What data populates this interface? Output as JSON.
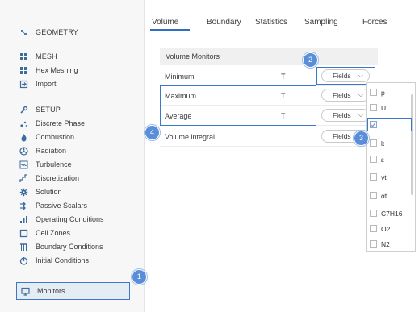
{
  "sidebar": {
    "items": [
      {
        "label": "GEOMETRY",
        "icon": "geometry-icon"
      },
      {
        "label": "MESH",
        "icon": "mesh-icon"
      },
      {
        "label": "Hex Meshing",
        "icon": "hex-meshing-icon"
      },
      {
        "label": "Import",
        "icon": "import-icon"
      },
      {
        "label": "SETUP",
        "icon": "wrench-icon"
      },
      {
        "label": "Discrete Phase",
        "icon": "discrete-phase-icon"
      },
      {
        "label": "Combustion",
        "icon": "flame-icon"
      },
      {
        "label": "Radiation",
        "icon": "radiation-icon"
      },
      {
        "label": "Turbulence",
        "icon": "turbulence-icon"
      },
      {
        "label": "Discretization",
        "icon": "discretization-icon"
      },
      {
        "label": "Solution",
        "icon": "gear-icon"
      },
      {
        "label": "Passive Scalars",
        "icon": "passive-scalars-icon"
      },
      {
        "label": "Operating Conditions",
        "icon": "operating-conditions-icon"
      },
      {
        "label": "Cell Zones",
        "icon": "cell-zones-icon"
      },
      {
        "label": "Boundary Conditions",
        "icon": "boundary-conditions-icon"
      },
      {
        "label": "Initial Conditions",
        "icon": "initial-conditions-icon"
      }
    ],
    "selected": {
      "label": "Monitors",
      "icon": "monitor-icon"
    }
  },
  "tabs": [
    "Volume",
    "Boundary",
    "Statistics",
    "Sampling",
    "Forces"
  ],
  "panel": {
    "title": "Volume Monitors",
    "rows": [
      {
        "name": "Minimum",
        "field": "T",
        "button": "Fields"
      },
      {
        "name": "Maximum",
        "field": "T",
        "button": "Fields"
      },
      {
        "name": "Average",
        "field": "T",
        "button": "Fields"
      },
      {
        "name": "Volume integral",
        "field": "",
        "button": "Fields"
      }
    ]
  },
  "dropdown": {
    "options": [
      {
        "label": "p",
        "checked": false
      },
      {
        "label": "U",
        "checked": false
      },
      {
        "label": "T",
        "checked": true
      },
      {
        "label": "k",
        "checked": false
      },
      {
        "label": "ε",
        "checked": false
      },
      {
        "label": "νt",
        "checked": false
      },
      {
        "label": "αt",
        "checked": false
      },
      {
        "label": "C7H16",
        "checked": false
      },
      {
        "label": "O2",
        "checked": false
      },
      {
        "label": "N2",
        "checked": false
      }
    ]
  },
  "badges": [
    "1",
    "2",
    "3",
    "4"
  ],
  "colors": {
    "accent": "#3a78c8",
    "badge": "#5b8ed8"
  }
}
